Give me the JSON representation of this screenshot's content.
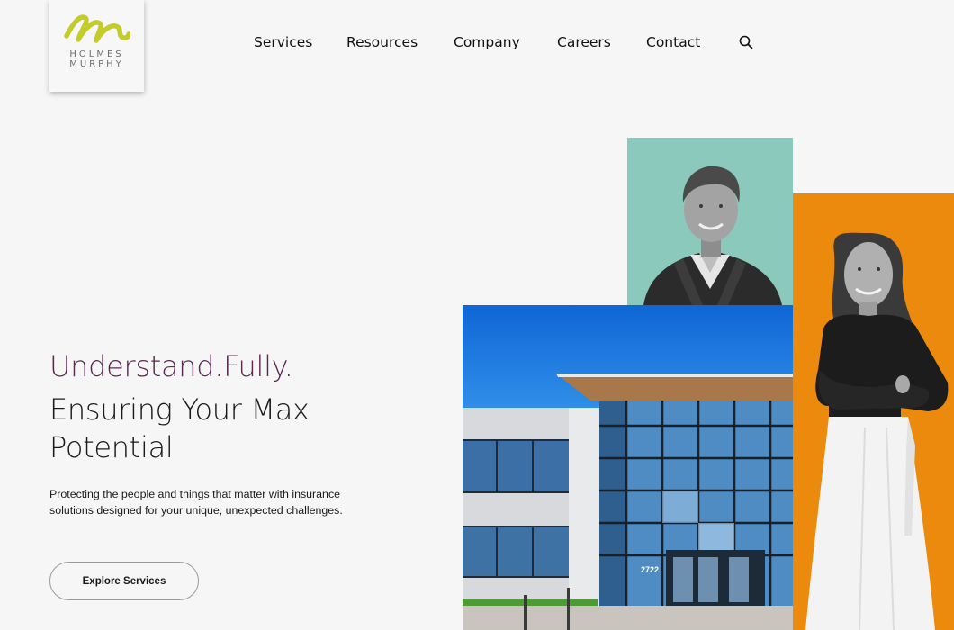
{
  "brand": {
    "line1": "HOLMES",
    "line2": "MURPHY",
    "logo_color": "#c3cc2a"
  },
  "nav": {
    "items": [
      "Services",
      "Resources",
      "Company",
      "Careers",
      "Contact"
    ],
    "search_icon": "search-icon"
  },
  "hero": {
    "tagline": "Understand.Fully.",
    "headline": "Ensuring Your Max Potential",
    "body": "Protecting the people and things that matter with insurance solutions designed for your unique, unexpected challenges.",
    "cta": "Explore Services",
    "tagline_color": "#5a2750"
  },
  "collage": {
    "teal": "#8cc9bd",
    "orange": "#ec8a0d",
    "building_sign": "2722"
  }
}
